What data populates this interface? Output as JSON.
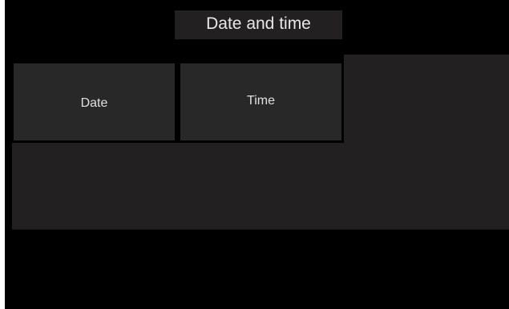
{
  "header": {
    "title": "Date and time"
  },
  "tiles": [
    {
      "label": "Date"
    },
    {
      "label": "Time"
    }
  ],
  "colors": {
    "background": "#000000",
    "panel": "#232021",
    "tile": "#282828",
    "text": "#e0e0e0"
  }
}
